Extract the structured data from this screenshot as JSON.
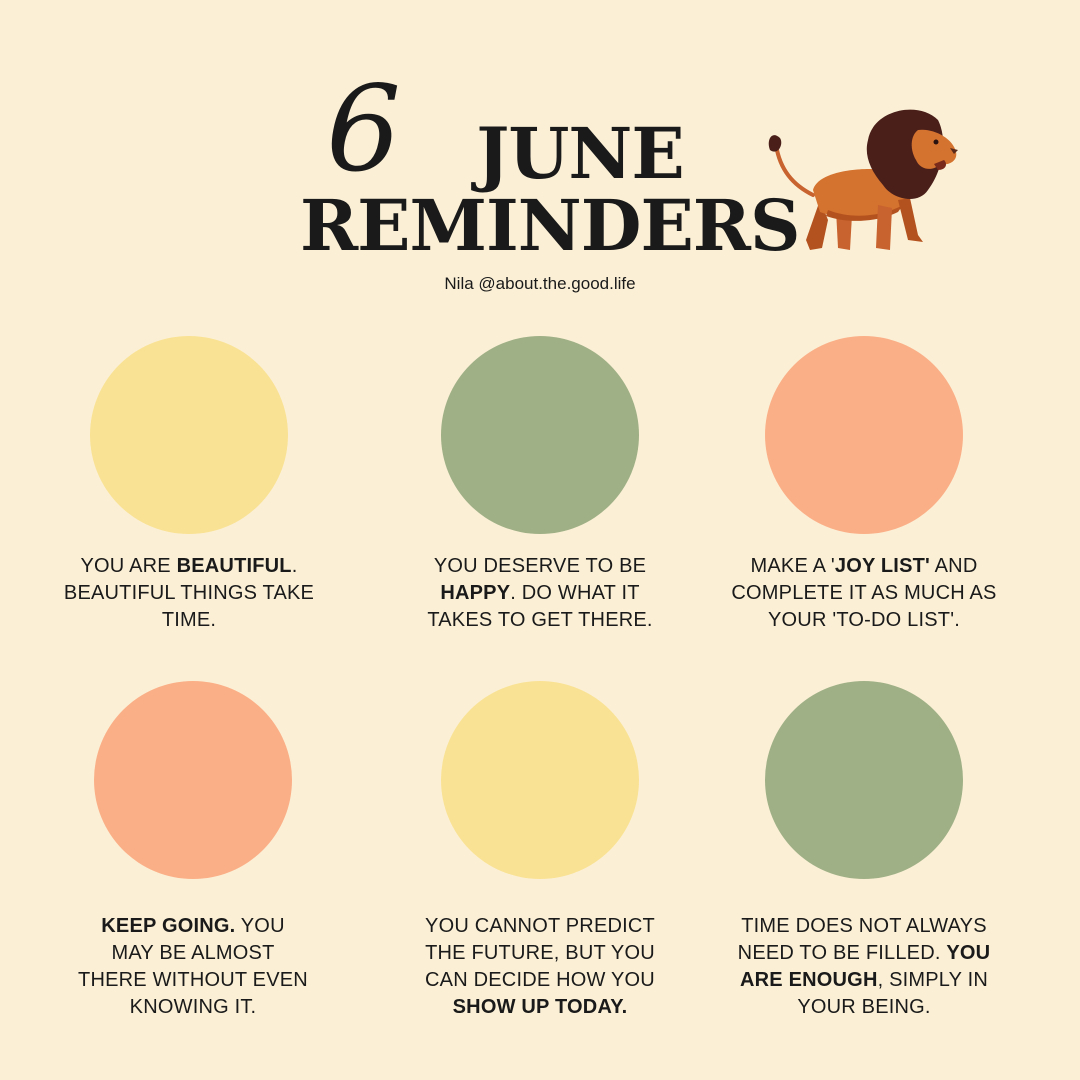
{
  "header": {
    "number": "6",
    "title_line1": "JUNE",
    "title_line2": "REMINDERS",
    "credit": "Nila @about.the.good.life"
  },
  "colors": {
    "background": "#FBF0D6",
    "yellow": "#FAE294",
    "green": "#A0B086",
    "peach": "#FBAF87"
  },
  "reminders": [
    {
      "color": "#FAE294",
      "parts": [
        {
          "t": "YOU ARE ",
          "b": false
        },
        {
          "t": "BEAUTIFUL",
          "b": true
        },
        {
          "t": ". BEAUTIFUL THINGS TAKE TIME.",
          "b": false
        }
      ]
    },
    {
      "color": "#A0B086",
      "parts": [
        {
          "t": "YOU DESERVE TO BE ",
          "b": false
        },
        {
          "t": "HAPPY",
          "b": true
        },
        {
          "t": ". DO WHAT IT TAKES TO GET THERE.",
          "b": false
        }
      ]
    },
    {
      "color": "#FBAF87",
      "parts": [
        {
          "t": "MAKE A '",
          "b": false
        },
        {
          "t": "JOY LIST'",
          "b": true
        },
        {
          "t": " AND COMPLETE IT AS MUCH AS YOUR 'TO-DO LIST'.",
          "b": false
        }
      ]
    },
    {
      "color": "#FBAF87",
      "parts": [
        {
          "t": "KEEP GOING.",
          "b": true
        },
        {
          "t": " YOU MAY BE ALMOST THERE WITHOUT EVEN KNOWING IT.",
          "b": false
        }
      ]
    },
    {
      "color": "#FAE294",
      "parts": [
        {
          "t": "YOU CANNOT PREDICT THE FUTURE, BUT YOU CAN DECIDE HOW YOU ",
          "b": false
        },
        {
          "t": "SHOW UP TODAY.",
          "b": true
        }
      ]
    },
    {
      "color": "#A0B086",
      "parts": [
        {
          "t": "TIME DOES NOT ALWAYS NEED TO BE FILLED. ",
          "b": false
        },
        {
          "t": "YOU ARE ENOUGH",
          "b": true
        },
        {
          "t": ", SIMPLY IN YOUR BEING.",
          "b": false
        }
      ]
    }
  ],
  "icons": [
    "lion-illustration"
  ]
}
